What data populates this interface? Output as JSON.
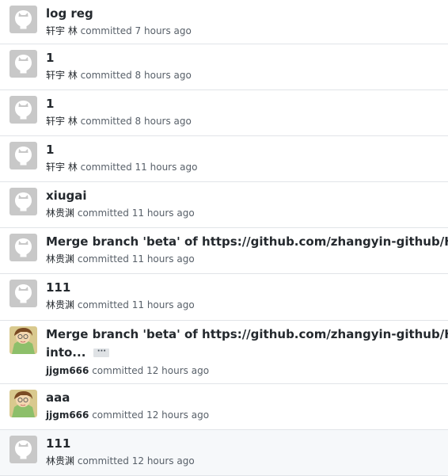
{
  "commits": [
    {
      "message": "log reg",
      "author": "轩宇 林",
      "action": "committed",
      "time": "7 hours ago",
      "avatar": "github-default"
    },
    {
      "message": "1",
      "author": "轩宇 林",
      "action": "committed",
      "time": "8 hours ago",
      "avatar": "github-default"
    },
    {
      "message": "1",
      "author": "轩宇 林",
      "action": "committed",
      "time": "8 hours ago",
      "avatar": "github-default"
    },
    {
      "message": "1",
      "author": "轩宇 林",
      "action": "committed",
      "time": "11 hours ago",
      "avatar": "github-default"
    },
    {
      "message": "xiugai",
      "author": "林贵渊",
      "action": "committed",
      "time": "11 hours ago",
      "avatar": "github-default"
    },
    {
      "message": "Merge branch 'beta' of https://github.com/zhangyin-github/HunterAdm",
      "author": "林贵渊",
      "action": "committed",
      "time": "11 hours ago",
      "avatar": "github-default"
    },
    {
      "message": "111",
      "author": "林贵渊",
      "action": "committed",
      "time": "11 hours ago",
      "avatar": "github-default"
    },
    {
      "message": "Merge branch 'beta' of https://github.com/zhangyin-github/Hunter",
      "message_line2": "into...",
      "ellipsis": "···",
      "author": "jjgm666",
      "action": "committed",
      "time": "12 hours ago",
      "avatar": "user-photo"
    },
    {
      "message": "aaa",
      "author": "jjgm666",
      "action": "committed",
      "time": "12 hours ago",
      "avatar": "user-photo"
    },
    {
      "message": "111",
      "author": "林贵渊",
      "action": "committed",
      "time": "12 hours ago",
      "avatar": "github-default"
    }
  ],
  "colors": {
    "avatar_bg": "#c8c8c8",
    "highlight_row": "#f6f8fa",
    "border": "#e1e4e8"
  }
}
